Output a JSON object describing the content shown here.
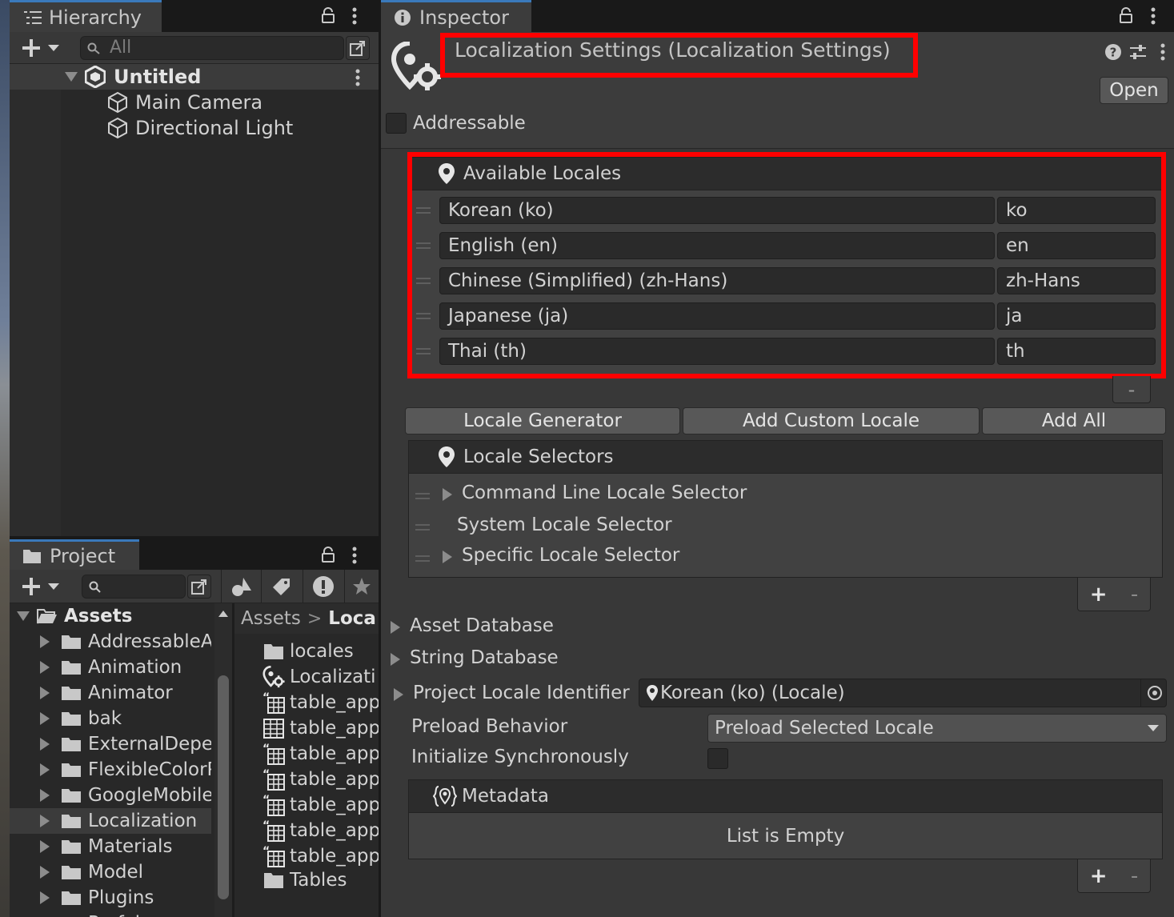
{
  "hierarchy": {
    "tab_label": "Hierarchy",
    "search_placeholder": "All",
    "scene_name": "Untitled",
    "objects": [
      "Main Camera",
      "Directional Light"
    ]
  },
  "project": {
    "tab_label": "Project",
    "tree_root": "Assets",
    "tree_items": [
      "AddressableA",
      "Animation",
      "Animator",
      "bak",
      "ExternalDepe",
      "FlexibleColorP",
      "GoogleMobile",
      "Localization",
      "Materials",
      "Model",
      "Plugins",
      "Prefab"
    ],
    "selected_tree_item": "Localization",
    "breadcrumb": [
      "Assets",
      "Loca"
    ],
    "files": [
      {
        "name": "locales",
        "icon": "folder-icon"
      },
      {
        "name": "Localizati",
        "icon": "localization-settings-icon"
      },
      {
        "name": "table_app",
        "icon": "string-table-icon"
      },
      {
        "name": "table_app",
        "icon": "table-icon"
      },
      {
        "name": "table_app",
        "icon": "string-table-icon"
      },
      {
        "name": "table_app",
        "icon": "string-table-icon"
      },
      {
        "name": "table_app",
        "icon": "string-table-icon"
      },
      {
        "name": "table_app",
        "icon": "string-table-icon"
      },
      {
        "name": "table_app",
        "icon": "string-table-icon"
      },
      {
        "name": "Tables",
        "icon": "folder-icon"
      }
    ]
  },
  "inspector": {
    "tab_label": "Inspector",
    "title": "Localization Settings (Localization Settings)",
    "open_label": "Open",
    "addressable_label": "Addressable",
    "available_locales": {
      "header": "Available Locales",
      "rows": [
        {
          "name": "Korean (ko)",
          "code": "ko"
        },
        {
          "name": "English (en)",
          "code": "en"
        },
        {
          "name": "Chinese (Simplified) (zh-Hans)",
          "code": "zh-Hans"
        },
        {
          "name": "Japanese (ja)",
          "code": "ja"
        },
        {
          "name": "Thai (th)",
          "code": "th"
        }
      ]
    },
    "buttons": {
      "locale_generator": "Locale Generator",
      "add_custom_locale": "Add Custom Locale",
      "add_all": "Add All"
    },
    "locale_selectors": {
      "header": "Locale Selectors",
      "items": [
        "Command Line Locale Selector",
        "System Locale Selector",
        "Specific Locale Selector"
      ]
    },
    "asset_database": "Asset Database",
    "string_database": "String Database",
    "project_locale_label": "Project Locale Identifier",
    "project_locale_value": "Korean (ko) (Locale)",
    "preload_behavior_label": "Preload Behavior",
    "preload_behavior_value": "Preload Selected Locale",
    "init_sync_label": "Initialize Synchronously",
    "metadata": {
      "header": "Metadata",
      "empty_text": "List is Empty"
    },
    "plus": "+",
    "minus": "-"
  },
  "colors": {
    "highlight": "#ff0000",
    "accent": "#3a79bb"
  }
}
